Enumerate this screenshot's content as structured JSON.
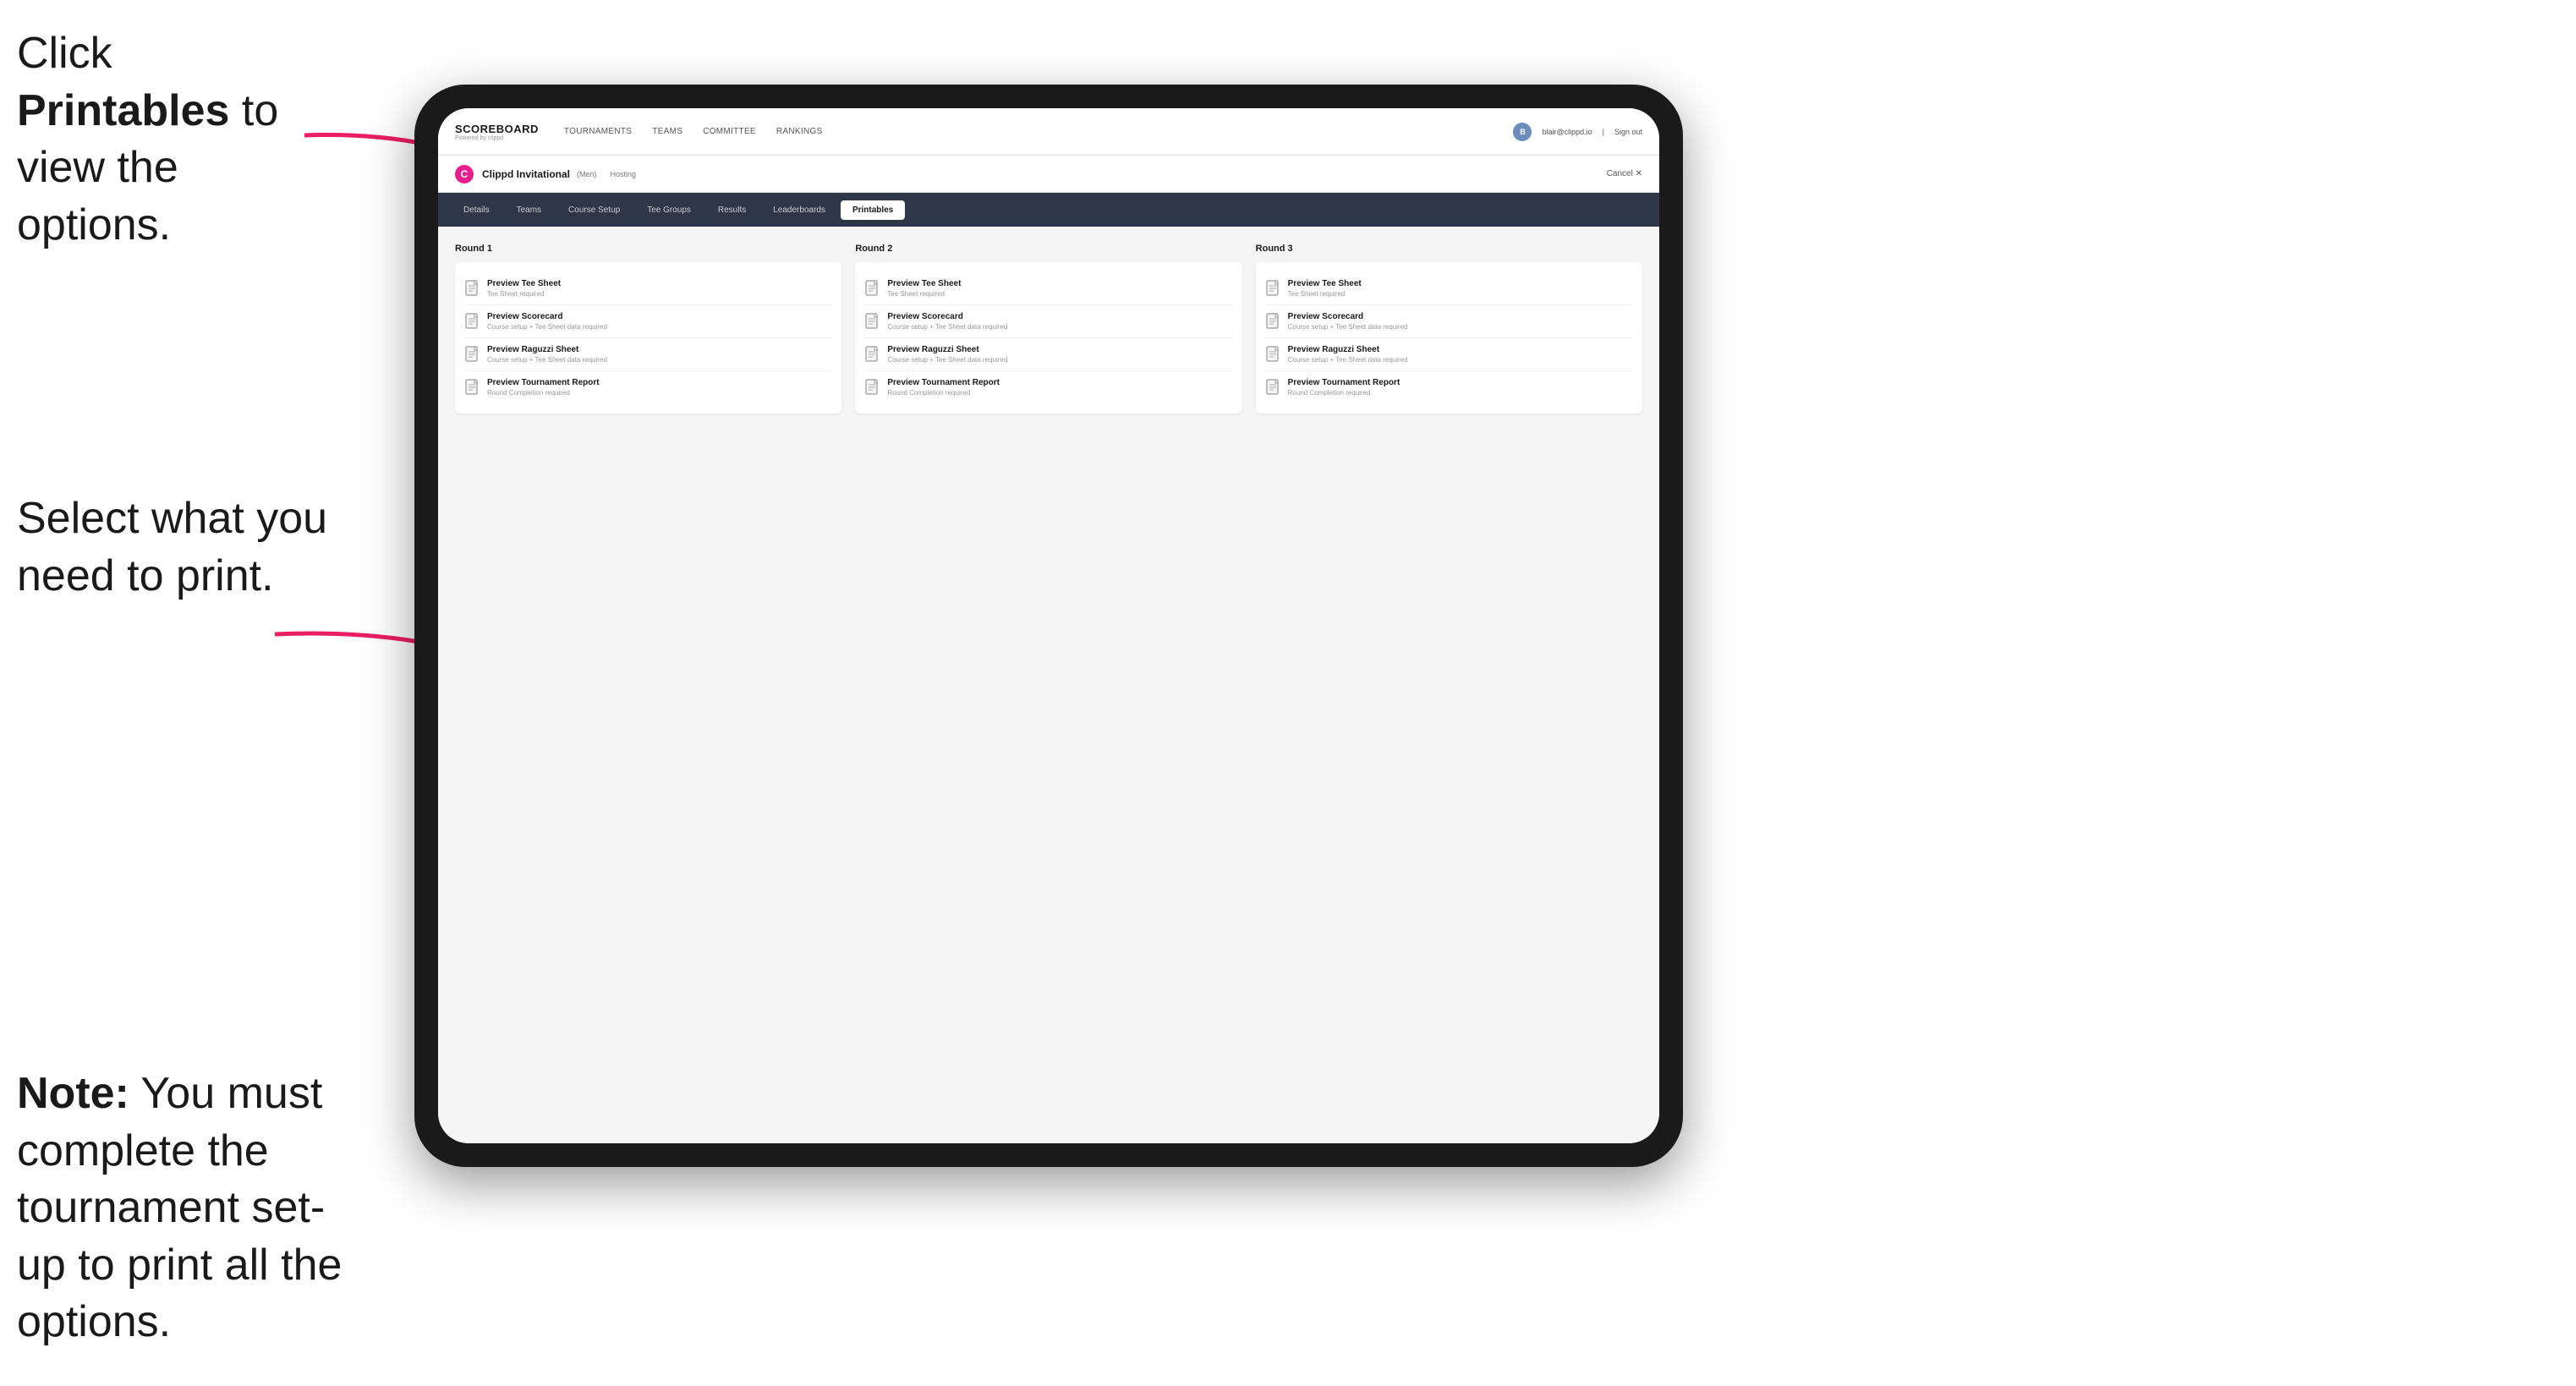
{
  "instructions": {
    "top_line1": "Click ",
    "top_bold": "Printables",
    "top_line2": " to",
    "top_line3": "view the options.",
    "mid": "Select what you need to print.",
    "bottom_bold": "Note:",
    "bottom_text": " You must complete the tournament set-up to print all the options."
  },
  "nav": {
    "logo_main": "SCOREBOARD",
    "logo_sub": "Powered by clippd",
    "links": [
      {
        "label": "TOURNAMENTS",
        "active": false
      },
      {
        "label": "TEAMS",
        "active": false
      },
      {
        "label": "COMMITTEE",
        "active": false
      },
      {
        "label": "RANKINGS",
        "active": false
      }
    ],
    "user_email": "blair@clippd.io",
    "sign_out": "Sign out",
    "user_avatar": "B"
  },
  "tournament": {
    "name": "Clippd Invitational",
    "bracket": "Men",
    "status": "Hosting",
    "cancel": "Cancel ✕"
  },
  "sub_nav": {
    "items": [
      {
        "label": "Details",
        "active": false
      },
      {
        "label": "Teams",
        "active": false
      },
      {
        "label": "Course Setup",
        "active": false
      },
      {
        "label": "Tee Groups",
        "active": false
      },
      {
        "label": "Results",
        "active": false
      },
      {
        "label": "Leaderboards",
        "active": false
      },
      {
        "label": "Printables",
        "active": true
      }
    ]
  },
  "rounds": [
    {
      "title": "Round 1",
      "items": [
        {
          "title": "Preview Tee Sheet",
          "subtitle": "Tee Sheet required"
        },
        {
          "title": "Preview Scorecard",
          "subtitle": "Course setup + Tee Sheet data required"
        },
        {
          "title": "Preview Raguzzi Sheet",
          "subtitle": "Course setup + Tee Sheet data required"
        },
        {
          "title": "Preview Tournament Report",
          "subtitle": "Round Completion required"
        }
      ]
    },
    {
      "title": "Round 2",
      "items": [
        {
          "title": "Preview Tee Sheet",
          "subtitle": "Tee Sheet required"
        },
        {
          "title": "Preview Scorecard",
          "subtitle": "Course setup + Tee Sheet data required"
        },
        {
          "title": "Preview Raguzzi Sheet",
          "subtitle": "Course setup + Tee Sheet data required"
        },
        {
          "title": "Preview Tournament Report",
          "subtitle": "Round Completion required"
        }
      ]
    },
    {
      "title": "Round 3",
      "items": [
        {
          "title": "Preview Tee Sheet",
          "subtitle": "Tee Sheet required"
        },
        {
          "title": "Preview Scorecard",
          "subtitle": "Course setup + Tee Sheet data required"
        },
        {
          "title": "Preview Raguzzi Sheet",
          "subtitle": "Course setup + Tee Sheet data required"
        },
        {
          "title": "Preview Tournament Report",
          "subtitle": "Round Completion required"
        }
      ]
    }
  ]
}
